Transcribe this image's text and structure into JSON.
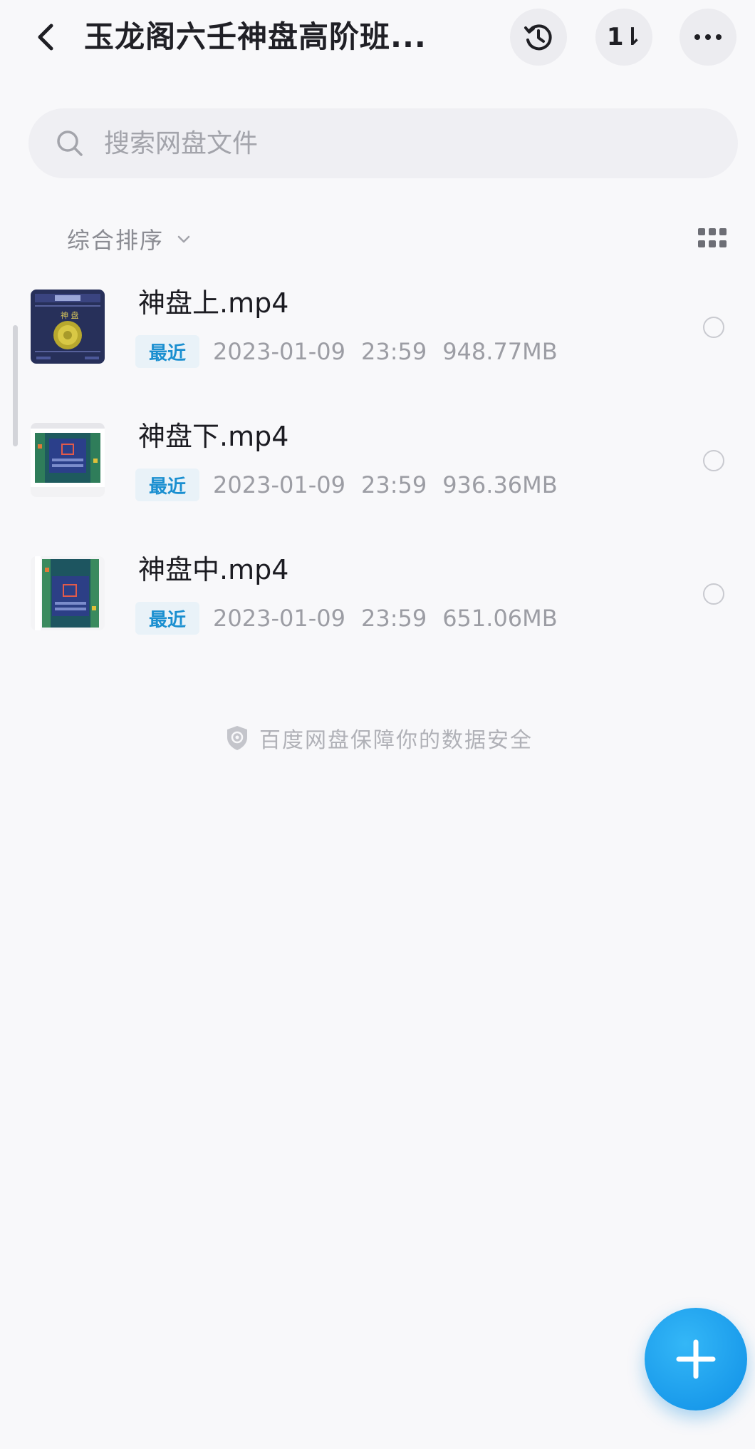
{
  "header": {
    "title": "玉龙阁六壬神盘高阶班...",
    "back_icon": "chevron-left-icon",
    "actions": [
      {
        "name": "history",
        "icon": "history-clock-icon"
      },
      {
        "name": "transfer",
        "icon": "transfer-updown-icon",
        "glyph": "1⇂"
      },
      {
        "name": "more",
        "icon": "more-dots-icon"
      }
    ]
  },
  "search": {
    "placeholder": "搜索网盘文件",
    "value": "",
    "icon": "search-icon"
  },
  "sort": {
    "label": "综合排序",
    "icon": "chevron-down-icon",
    "view_toggle_icon": "grid-view-icon"
  },
  "files": [
    {
      "name": "神盘上.mp4",
      "tag": "最近",
      "date": "2023-01-09",
      "time": "23:59",
      "size": "948.77MB",
      "selected": false
    },
    {
      "name": "神盘下.mp4",
      "tag": "最近",
      "date": "2023-01-09",
      "time": "23:59",
      "size": "936.36MB",
      "selected": false
    },
    {
      "name": "神盘中.mp4",
      "tag": "最近",
      "date": "2023-01-09",
      "time": "23:59",
      "size": "651.06MB",
      "selected": false
    }
  ],
  "footer": {
    "security_note": "百度网盘保障你的数据安全",
    "security_icon": "shield-icon"
  },
  "fab": {
    "icon": "plus-icon"
  },
  "colors": {
    "accent": "#1a8fd0",
    "fab": "#1b9ff0",
    "tag_bg": "#e9f2f8",
    "background": "#f8f8fa"
  }
}
